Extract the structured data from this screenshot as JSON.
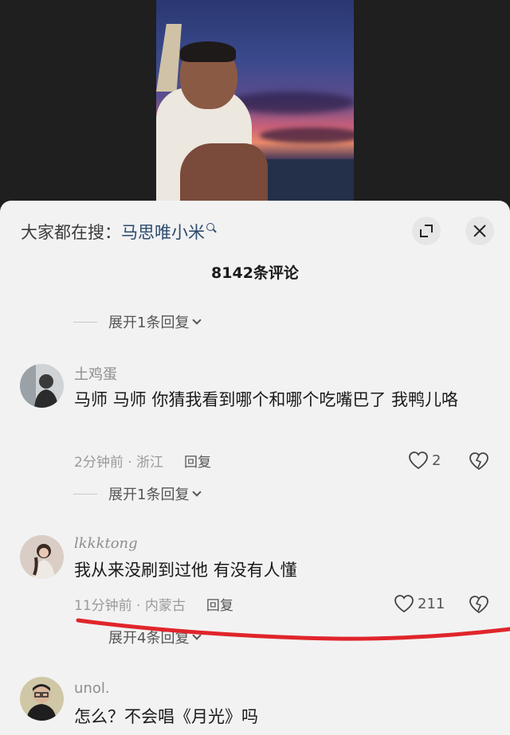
{
  "header": {
    "search_prefix": "大家都在搜：",
    "search_term": "马思唯小米",
    "comment_count": "8142条评论"
  },
  "expand_replies": [
    {
      "label": "展开1条回复"
    },
    {
      "label": "展开1条回复"
    },
    {
      "label": "展开4条回复"
    }
  ],
  "comments": [
    {
      "username": "土鸡蛋",
      "text": "马师 马师 你猜我看到哪个和哪个吃嘴巴了 我鸭儿咯",
      "time": "2分钟前 · 浙江",
      "reply_label": "回复",
      "likes": "2"
    },
    {
      "username": "lkkktong",
      "text": "我从来没刷到过他 有没有人懂",
      "time": "11分钟前 · 内蒙古",
      "reply_label": "回复",
      "likes": "211"
    },
    {
      "username": "unol.",
      "text": "怎么？不会唱《月光》吗",
      "time": "",
      "reply_label": "",
      "likes": ""
    }
  ],
  "colors": {
    "sheet_bg": "#f2f2f2",
    "search_term": "#2c4a6e",
    "annotation_red": "#e0252b"
  },
  "icons": [
    "search-icon",
    "expand-icon",
    "close-icon",
    "chevron-down-icon",
    "heart-icon",
    "dislike-icon"
  ]
}
